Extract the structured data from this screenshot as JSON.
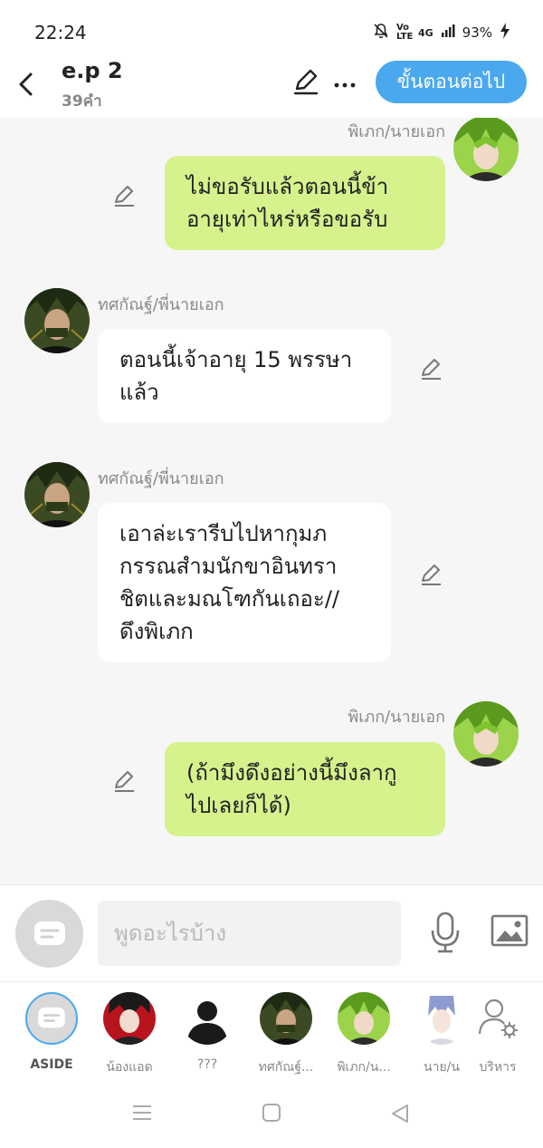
{
  "status_bar": {
    "time": "22:24",
    "battery": "93%",
    "network": "4G",
    "volte": "Vo LTE",
    "icons": [
      "bell-off-icon",
      "volte-icon",
      "signal-icon",
      "battery-icon"
    ]
  },
  "header": {
    "title": "e.p 2",
    "word_count": "39คำ",
    "next_button": "ขั้นตอนต่อไป"
  },
  "messages": [
    {
      "side": "right",
      "name": "พิเภก/นายเอก",
      "lines": [
        "ไม่ขอรับแล้วตอนนี้ข้า",
        "อายุเท่าไหร่หรือขอรับ"
      ]
    },
    {
      "side": "left",
      "name": "ทศกัณฐ์/พี่นายเอก",
      "lines": [
        "ตอนนี้เจ้าอายุ 15 พรรษา",
        "แล้ว"
      ]
    },
    {
      "side": "left",
      "name": "ทศกัณฐ์/พี่นายเอก",
      "lines": [
        "เอาล่ะเรารีบไปหากุมภ",
        "กรรณสำมนักขาอินทรา",
        "ชิตและมณโฑกันเถอะ//",
        "ดึงพิเภก"
      ]
    },
    {
      "side": "right",
      "name": "พิเภก/นายเอก",
      "lines": [
        "(ถ้ามึงดึงอย่างนี้มึงลากู",
        "ไปเลยก็ได้)"
      ]
    }
  ],
  "input": {
    "placeholder": "พูดอะไรบ้าง"
  },
  "characters": [
    {
      "label": "ASIDE"
    },
    {
      "label": "น้องแอด"
    },
    {
      "label": "???"
    },
    {
      "label": "ทศกัณฐ์..."
    },
    {
      "label": "พิเภก/น..."
    },
    {
      "label": "นาย/น"
    },
    {
      "label": "บริหาร"
    }
  ],
  "colors": {
    "accent": "#4aa8ee",
    "my_bubble": "#d6f28d",
    "their_bubble": "#ffffff",
    "chat_bg": "#f6f6f6"
  }
}
